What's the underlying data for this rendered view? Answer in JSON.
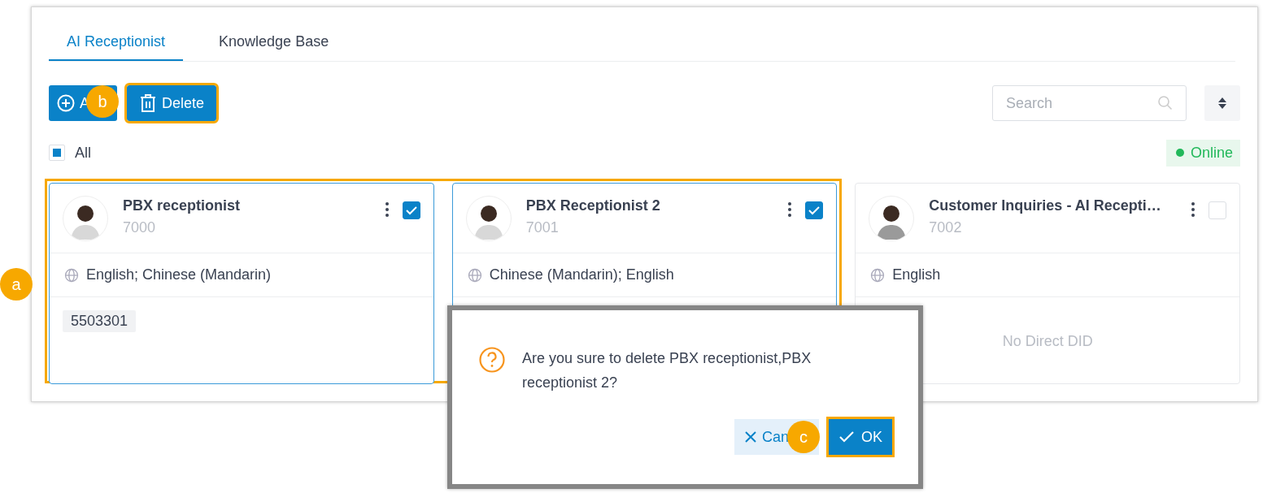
{
  "tabs": [
    {
      "label": "AI Receptionist",
      "selected": true
    },
    {
      "label": "Knowledge Base",
      "selected": false
    }
  ],
  "toolbar": {
    "add_button": {
      "label": "A"
    },
    "delete_button": {
      "label": "Delete",
      "highlighted": true
    },
    "search": {
      "placeholder": "Search"
    }
  },
  "select_all": {
    "label": "All",
    "indeterminate": true
  },
  "status": {
    "label": "Online",
    "color": "#22b85a"
  },
  "cards_highlighted": true,
  "cards": [
    {
      "name": "PBX receptionist",
      "extension": "7000",
      "checked": true,
      "languages": "English; Chinese (Mandarin)",
      "did": "5503301"
    },
    {
      "name": "PBX Receptionist 2",
      "extension": "7001",
      "checked": true,
      "languages": "Chinese (Mandarin); English"
    },
    {
      "name": "Customer Inquiries - AI Recepti…",
      "extension": "7002",
      "checked": false,
      "languages": "English",
      "did_empty_text": "No Direct DID"
    }
  ],
  "dialog": {
    "message": "Are you sure to delete PBX receptionist,PBX receptionist 2?",
    "cancel_button": {
      "label": "Can"
    },
    "ok_button": {
      "label": "OK",
      "highlighted": true
    }
  },
  "callouts": [
    {
      "label": "a"
    },
    {
      "label": "b"
    },
    {
      "label": "c"
    }
  ]
}
